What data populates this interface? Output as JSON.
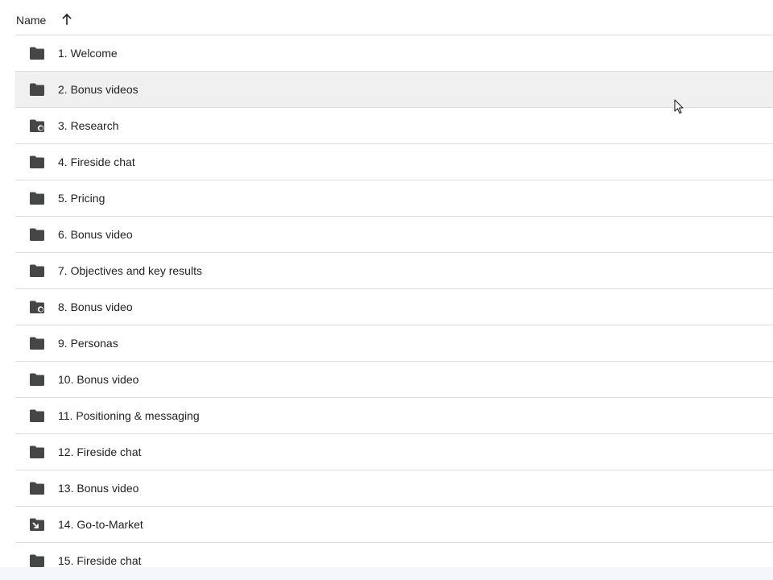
{
  "header": {
    "name_label": "Name",
    "sort_icon": "arrow-upward-icon"
  },
  "rows": [
    {
      "label": "1. Welcome",
      "icon": "folder-icon"
    },
    {
      "label": "2. Bonus videos",
      "icon": "folder-icon",
      "hovered": true
    },
    {
      "label": "3. Research",
      "icon": "shared-folder-icon"
    },
    {
      "label": "4. Fireside chat",
      "icon": "folder-icon"
    },
    {
      "label": "5. Pricing",
      "icon": "folder-icon"
    },
    {
      "label": "6. Bonus video",
      "icon": "folder-icon"
    },
    {
      "label": "7. Objectives and key results",
      "icon": "folder-icon"
    },
    {
      "label": "8. Bonus video",
      "icon": "shared-folder-icon"
    },
    {
      "label": "9. Personas",
      "icon": "folder-icon"
    },
    {
      "label": "10. Bonus video",
      "icon": "folder-icon"
    },
    {
      "label": "11. Positioning & messaging",
      "icon": "folder-icon"
    },
    {
      "label": "12. Fireside chat",
      "icon": "folder-icon"
    },
    {
      "label": "13. Bonus video",
      "icon": "folder-icon"
    },
    {
      "label": "14. Go-to-Market",
      "icon": "shortcut-folder-icon"
    },
    {
      "label": "15. Fireside chat",
      "icon": "folder-icon"
    }
  ],
  "colors": {
    "icon": "#444746",
    "divider": "#dadce0",
    "hover_row": "#f0f0f0"
  }
}
